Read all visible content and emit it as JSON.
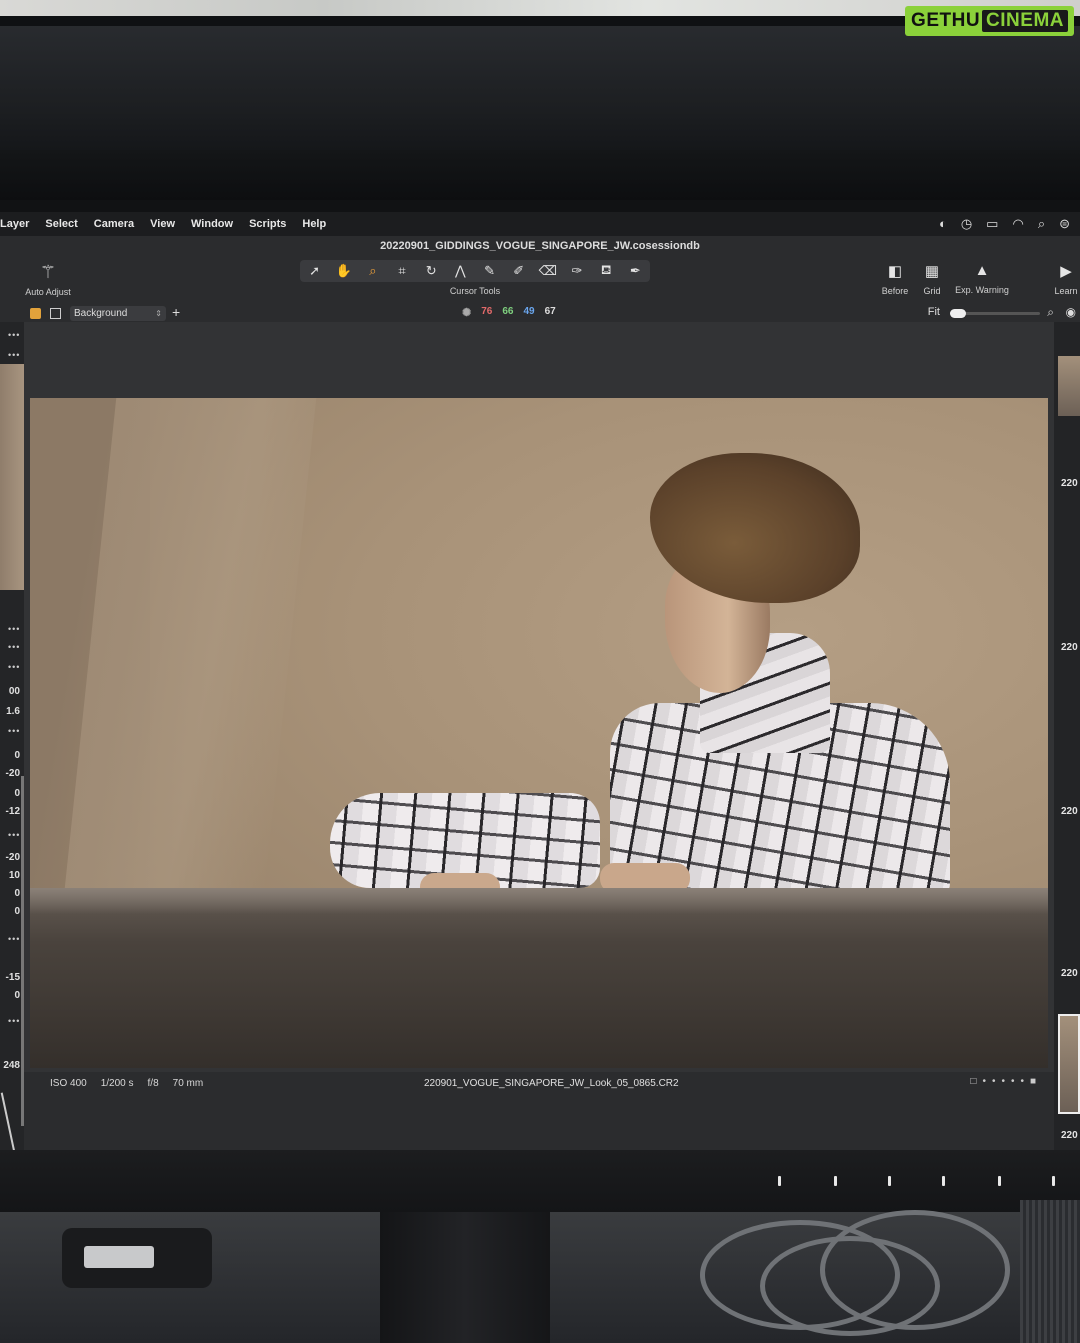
{
  "watermark": {
    "part1": "GETHU",
    "part2": "CINEMA"
  },
  "menubar": {
    "items": [
      "Layer",
      "Select",
      "Camera",
      "View",
      "Window",
      "Scripts",
      "Help"
    ],
    "status_icons": [
      "creative-cloud-icon",
      "clock-icon",
      "battery-icon",
      "wifi-icon",
      "search-icon",
      "control-center-icon"
    ]
  },
  "document": {
    "title": "20220901_GIDDINGS_VOGUE_SINGAPORE_JW.cosessiondb"
  },
  "toolbar": {
    "auto_adjust_label": "Auto Adjust",
    "cursor_tools_label": "Cursor Tools",
    "before_label": "Before",
    "grid_label": "Grid",
    "exp_warning_label": "Exp. Warning",
    "learn_label": "Learn",
    "tool_icons": [
      "select-icon",
      "pan-icon",
      "zoom-icon",
      "crop-icon",
      "rotate-icon",
      "keystone-icon",
      "picker-icon",
      "brush-icon",
      "eraser-icon",
      "gradient-icon",
      "fill-icon",
      "annotate-icon"
    ],
    "active_tool": "zoom-icon"
  },
  "subbar": {
    "layer": "Background",
    "readout": {
      "r": "76",
      "g": "66",
      "b": "49",
      "l": "67"
    },
    "fit_label": "Fit"
  },
  "left_panel": {
    "values": [
      "00",
      "1.6",
      "0",
      "-20",
      "0",
      "-12",
      "-20",
      "10",
      "0",
      "0",
      "-15",
      "0",
      "248"
    ]
  },
  "viewer": {
    "exif": {
      "iso": "ISO 400",
      "shutter": "1/200 s",
      "aperture": "f/8",
      "focal": "70 mm"
    },
    "filename": "220901_VOGUE_SINGAPORE_JW_Look_05_0865.CR2"
  },
  "browser_strip": {
    "labels": [
      "220",
      "220",
      "220",
      "220",
      "220",
      "220"
    ]
  },
  "colors": {
    "accent": "#f2a33a",
    "red": "#e36a6a",
    "green": "#7fd07f",
    "blue": "#6aa6ee"
  }
}
